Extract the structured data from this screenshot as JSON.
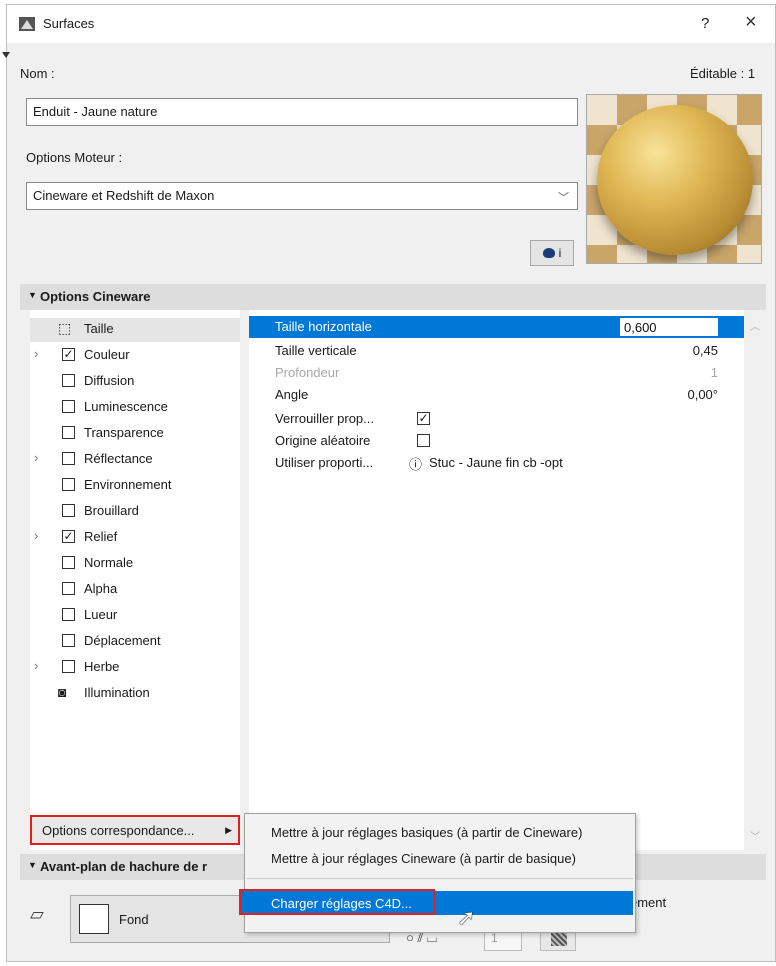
{
  "window": {
    "title": "Surfaces",
    "help_label": "?",
    "close_label": "×"
  },
  "header": {
    "name_label": "Nom :",
    "editable_label": "Éditable : 1",
    "name_value": "Enduit - Jaune nature",
    "engine_label": "Options Moteur :",
    "engine_value": "Cineware et Redshift de Maxon",
    "info_button_label": "i"
  },
  "cineware_section": {
    "title": "Options Cineware",
    "channels": [
      {
        "label": "Taille",
        "checked": null,
        "expandable": false,
        "icon": "size-icon"
      },
      {
        "label": "Couleur",
        "checked": true,
        "expandable": true
      },
      {
        "label": "Diffusion",
        "checked": false,
        "expandable": false
      },
      {
        "label": "Luminescence",
        "checked": false,
        "expandable": false
      },
      {
        "label": "Transparence",
        "checked": false,
        "expandable": false
      },
      {
        "label": "Réflectance",
        "checked": false,
        "expandable": true
      },
      {
        "label": "Environnement",
        "checked": false,
        "expandable": false
      },
      {
        "label": "Brouillard",
        "checked": false,
        "expandable": false
      },
      {
        "label": "Relief",
        "checked": true,
        "expandable": true
      },
      {
        "label": "Normale",
        "checked": false,
        "expandable": false
      },
      {
        "label": "Alpha",
        "checked": false,
        "expandable": false
      },
      {
        "label": "Lueur",
        "checked": false,
        "expandable": false
      },
      {
        "label": "Déplacement",
        "checked": false,
        "expandable": false
      },
      {
        "label": "Herbe",
        "checked": false,
        "expandable": true
      },
      {
        "label": "Illumination",
        "checked": null,
        "expandable": false,
        "icon": "illumination-icon"
      }
    ],
    "properties": [
      {
        "key": "Taille horizontale",
        "value": "0,600"
      },
      {
        "key": "Taille verticale",
        "value": "0,45"
      },
      {
        "key": "Profondeur",
        "value": "1"
      },
      {
        "key": "Angle",
        "value": "0,00°"
      },
      {
        "key": "Verrouiller prop...",
        "value": ""
      },
      {
        "key": "Origine aléatoire",
        "value": ""
      },
      {
        "key": "Utiliser proporti...",
        "value": "Stuc - Jaune fin cb -opt"
      }
    ]
  },
  "options_button": {
    "label": "Options correspondance..."
  },
  "context_menu": {
    "items": [
      "Mettre à jour réglages basiques (à partir de Cineware)",
      "Mettre à jour réglages Cineware (à partir de basique)",
      "Charger réglages C4D..."
    ]
  },
  "foreground_section": {
    "title": "Avant-plan de hachure de r",
    "fond_label": "Fond",
    "trailing_text": "ément",
    "number_value": "1"
  },
  "colors": {
    "selection": "#0078d7",
    "highlight_border": "#e02020"
  }
}
